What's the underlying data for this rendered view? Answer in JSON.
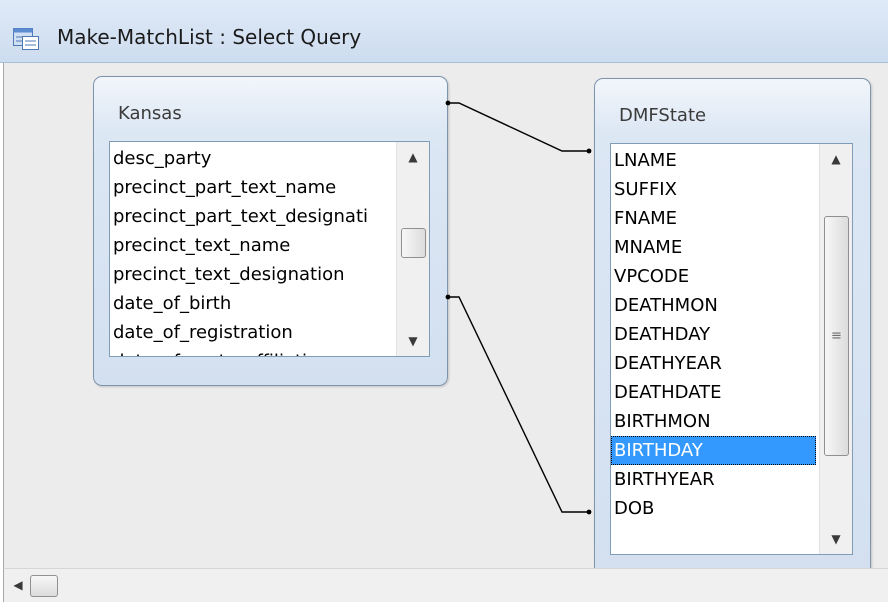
{
  "window": {
    "title": "Make-MatchList : Select Query",
    "icon": "query-icon"
  },
  "tables": [
    {
      "name": "Kansas",
      "fields": [
        "desc_party",
        "precinct_part_text_name",
        "precinct_part_text_designati",
        "precinct_text_name",
        "precinct_text_designation",
        "date_of_birth",
        "date_of_registration",
        "date_of_party_affiliation"
      ]
    },
    {
      "name": "DMFState",
      "fields": [
        "LNAME",
        "SUFFIX",
        "FNAME",
        "MNAME",
        "VPCODE",
        "DEATHMON",
        "DEATHDAY",
        "DEATHYEAR",
        "DEATHDATE",
        "BIRTHMON",
        "BIRTHDAY",
        "BIRTHYEAR",
        "DOB"
      ],
      "selected_field": "BIRTHDAY"
    }
  ],
  "scrollbar": {
    "up_arrow": "▲",
    "down_arrow": "▼",
    "left_arrow": "◀",
    "grip": "≡"
  },
  "colors": {
    "selection": "#3399ff",
    "title_bar": "#dfeaf7",
    "table_header": "#dce7f4"
  }
}
